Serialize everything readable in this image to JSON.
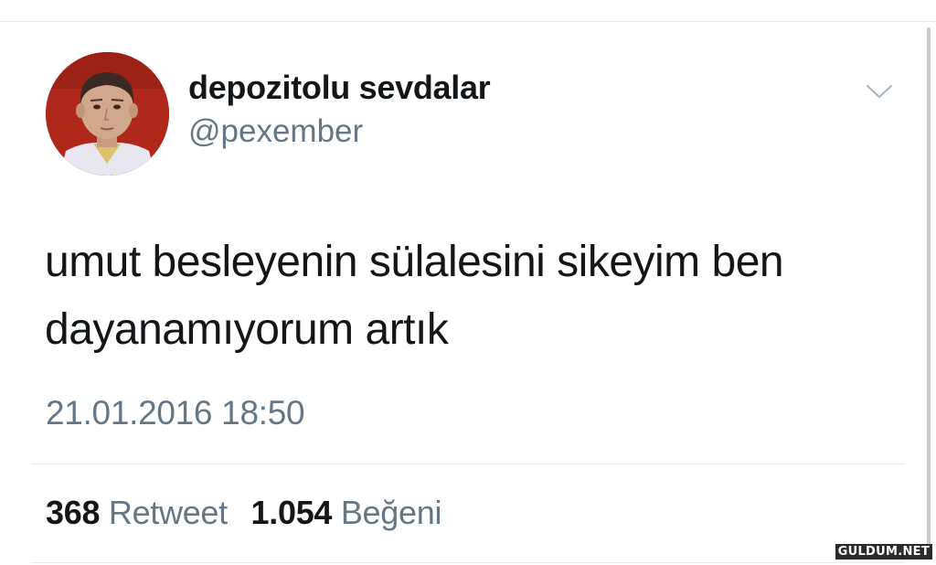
{
  "tweet": {
    "display_name": "depozitolu sevdalar",
    "username": "@pexember",
    "text_lines": [
      "umut besleyenin sülalesini sikeyim ben",
      "dayanamıyorum artık"
    ],
    "timestamp": "21.01.2016 18:50",
    "retweets": {
      "count": "368",
      "label": "Retweet"
    },
    "likes": {
      "count": "1.054",
      "label": "Beğeni"
    }
  },
  "icons": {
    "menu": "chevron-down-icon",
    "avatar": "avatar-photo"
  },
  "watermark": "GULDUM.NET",
  "colors": {
    "text_primary": "#14171a",
    "text_secondary": "#657786",
    "divider": "#e6ecf0",
    "avatar_background": "#b22a1e"
  }
}
